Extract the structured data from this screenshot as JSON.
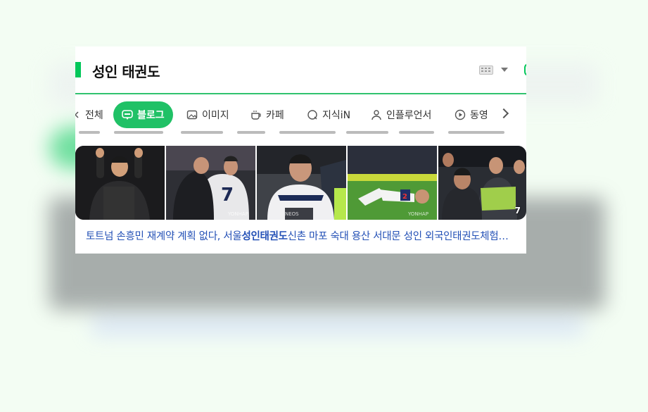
{
  "search": {
    "query": "성인 태권도"
  },
  "tabs": [
    {
      "label": "전체",
      "icon": "search-icon"
    },
    {
      "label": "블로그",
      "icon": "blog-icon",
      "active": true
    },
    {
      "label": "이미지",
      "icon": "image-icon"
    },
    {
      "label": "카페",
      "icon": "cafe-icon"
    },
    {
      "label": "지식iN",
      "icon": "qa-icon"
    },
    {
      "label": "인플루언서",
      "icon": "person-icon"
    },
    {
      "label": "동영",
      "icon": "play-icon"
    }
  ],
  "result": {
    "photo_count": "7",
    "watermark": "YONHAP",
    "sponsor_text": "NEOS",
    "caption_pre": "토트넘 손흥민 재계약 계획 없다, 서울",
    "caption_bold": "성인태권도",
    "caption_post": "신촌 마포 숙대 용산 서대문 성인 외국인태권도체험…"
  },
  "colors": {
    "accent": "#03c75a",
    "active_tab": "#20c166",
    "link": "#2350b6",
    "page_bg": "#f3fdf3"
  }
}
